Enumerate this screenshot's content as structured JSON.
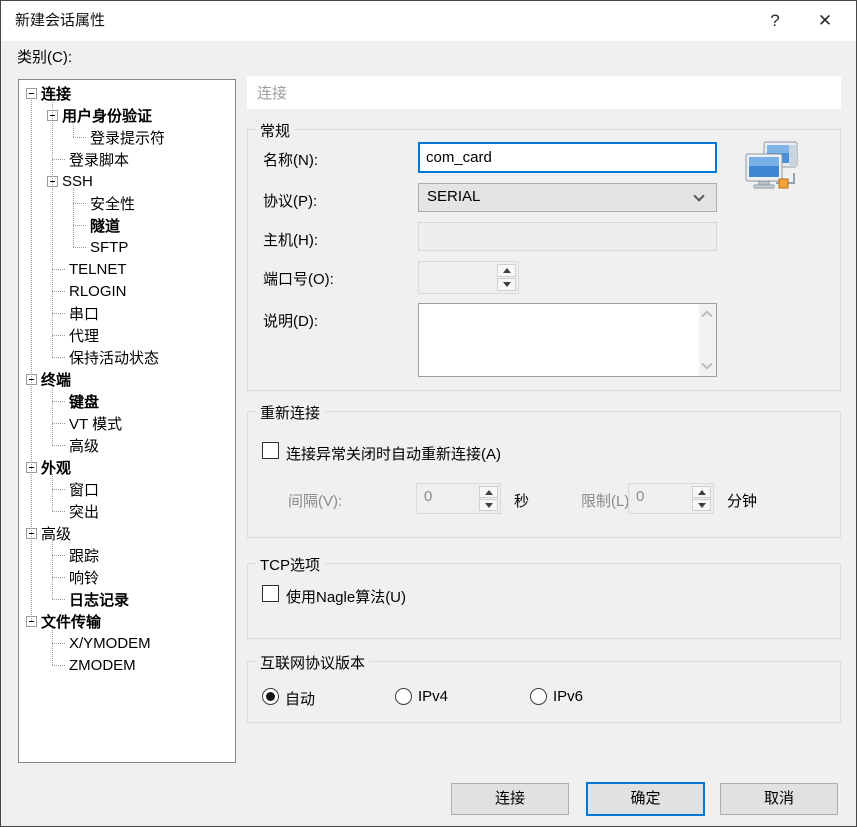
{
  "window": {
    "title": "新建会话属性",
    "help_glyph": "?",
    "close_glyph": "✕"
  },
  "category": {
    "label": "类别(C):"
  },
  "tree": {
    "items": [
      {
        "label": "连接",
        "depth": 0,
        "bold": true,
        "expander": true
      },
      {
        "label": "用户身份验证",
        "depth": 1,
        "bold": true,
        "expander": true
      },
      {
        "label": "登录提示符",
        "depth": 2,
        "bold": false,
        "expander": false
      },
      {
        "label": "登录脚本",
        "depth": 1,
        "bold": false,
        "expander": false
      },
      {
        "label": "SSH",
        "depth": 1,
        "bold": false,
        "expander": true
      },
      {
        "label": "安全性",
        "depth": 2,
        "bold": false,
        "expander": false
      },
      {
        "label": "隧道",
        "depth": 2,
        "bold": true,
        "expander": false
      },
      {
        "label": "SFTP",
        "depth": 2,
        "bold": false,
        "expander": false
      },
      {
        "label": "TELNET",
        "depth": 1,
        "bold": false,
        "expander": false
      },
      {
        "label": "RLOGIN",
        "depth": 1,
        "bold": false,
        "expander": false
      },
      {
        "label": "串口",
        "depth": 1,
        "bold": false,
        "expander": false
      },
      {
        "label": "代理",
        "depth": 1,
        "bold": false,
        "expander": false
      },
      {
        "label": "保持活动状态",
        "depth": 1,
        "bold": false,
        "expander": false
      },
      {
        "label": "终端",
        "depth": 0,
        "bold": true,
        "expander": true
      },
      {
        "label": "键盘",
        "depth": 1,
        "bold": true,
        "expander": false
      },
      {
        "label": "VT 模式",
        "depth": 1,
        "bold": false,
        "expander": false
      },
      {
        "label": "高级",
        "depth": 1,
        "bold": false,
        "expander": false
      },
      {
        "label": "外观",
        "depth": 0,
        "bold": true,
        "expander": true
      },
      {
        "label": "窗口",
        "depth": 1,
        "bold": false,
        "expander": false
      },
      {
        "label": "突出",
        "depth": 1,
        "bold": false,
        "expander": false
      },
      {
        "label": "高级",
        "depth": 0,
        "bold": false,
        "expander": true
      },
      {
        "label": "跟踪",
        "depth": 1,
        "bold": false,
        "expander": false
      },
      {
        "label": "响铃",
        "depth": 1,
        "bold": false,
        "expander": false
      },
      {
        "label": "日志记录",
        "depth": 1,
        "bold": true,
        "expander": false
      },
      {
        "label": "文件传输",
        "depth": 0,
        "bold": true,
        "expander": true
      },
      {
        "label": "X/YMODEM",
        "depth": 1,
        "bold": false,
        "expander": false
      },
      {
        "label": "ZMODEM",
        "depth": 1,
        "bold": false,
        "expander": false
      }
    ]
  },
  "panel": {
    "header": "连接",
    "general": {
      "title": "常规",
      "name_label": "名称(N):",
      "name_value": "com_card",
      "protocol_label": "协议(P):",
      "protocol_value": "SERIAL",
      "host_label": "主机(H):",
      "host_value": "",
      "port_label": "端口号(O):",
      "port_value": "",
      "desc_label": "说明(D):",
      "desc_value": ""
    },
    "reconnect": {
      "title": "重新连接",
      "checkbox_label": "连接异常关闭时自动重新连接(A)",
      "checkbox_checked": false,
      "interval_label": "间隔(V):",
      "interval_value": "0",
      "interval_unit": "秒",
      "limit_label": "限制(L):",
      "limit_value": "0",
      "limit_unit": "分钟"
    },
    "tcp": {
      "title": "TCP选项",
      "nagle_label": "使用Nagle算法(U)",
      "nagle_checked": false
    },
    "ip_version": {
      "title": "互联网协议版本",
      "options": [
        {
          "label": "自动",
          "selected": true
        },
        {
          "label": "IPv4",
          "selected": false
        },
        {
          "label": "IPv6",
          "selected": false
        }
      ]
    }
  },
  "footer": {
    "connect_label": "连接",
    "ok_label": "确定",
    "cancel_label": "取消"
  },
  "colors": {
    "accent": "#0078d7",
    "dialog_bg": "#f0f0f0",
    "titlebar_bg": "#ffffff",
    "panel_header_text": "#9d9d9d"
  }
}
